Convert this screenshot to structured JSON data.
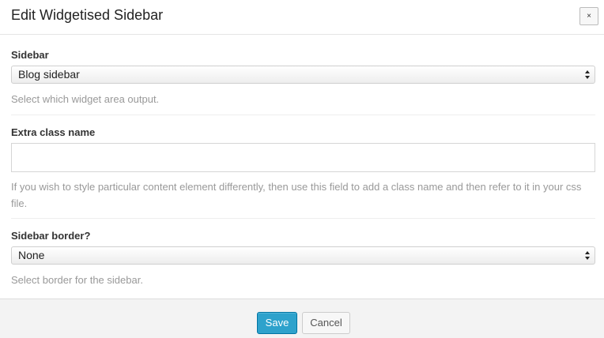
{
  "dialog": {
    "title": "Edit Widgetised Sidebar",
    "close_label": "×"
  },
  "fields": {
    "sidebar": {
      "label": "Sidebar",
      "selected": "Blog sidebar",
      "hint": "Select which widget area output."
    },
    "extra_class": {
      "label": "Extra class name",
      "value": "",
      "hint": "If you wish to style particular content element differently, then use this field to add a class name and then refer to it in your css file."
    },
    "border": {
      "label": "Sidebar border?",
      "selected": "None",
      "hint": "Select border for the sidebar."
    }
  },
  "footer": {
    "save_label": "Save",
    "cancel_label": "Cancel"
  },
  "colors": {
    "primary_button": "#2ea2cc",
    "primary_button_border": "#0074a2",
    "footer_background": "#f3f3f3",
    "hint_text": "#999999"
  },
  "icons": {
    "close": "close-icon",
    "select_arrows": "select-arrows-icon"
  }
}
